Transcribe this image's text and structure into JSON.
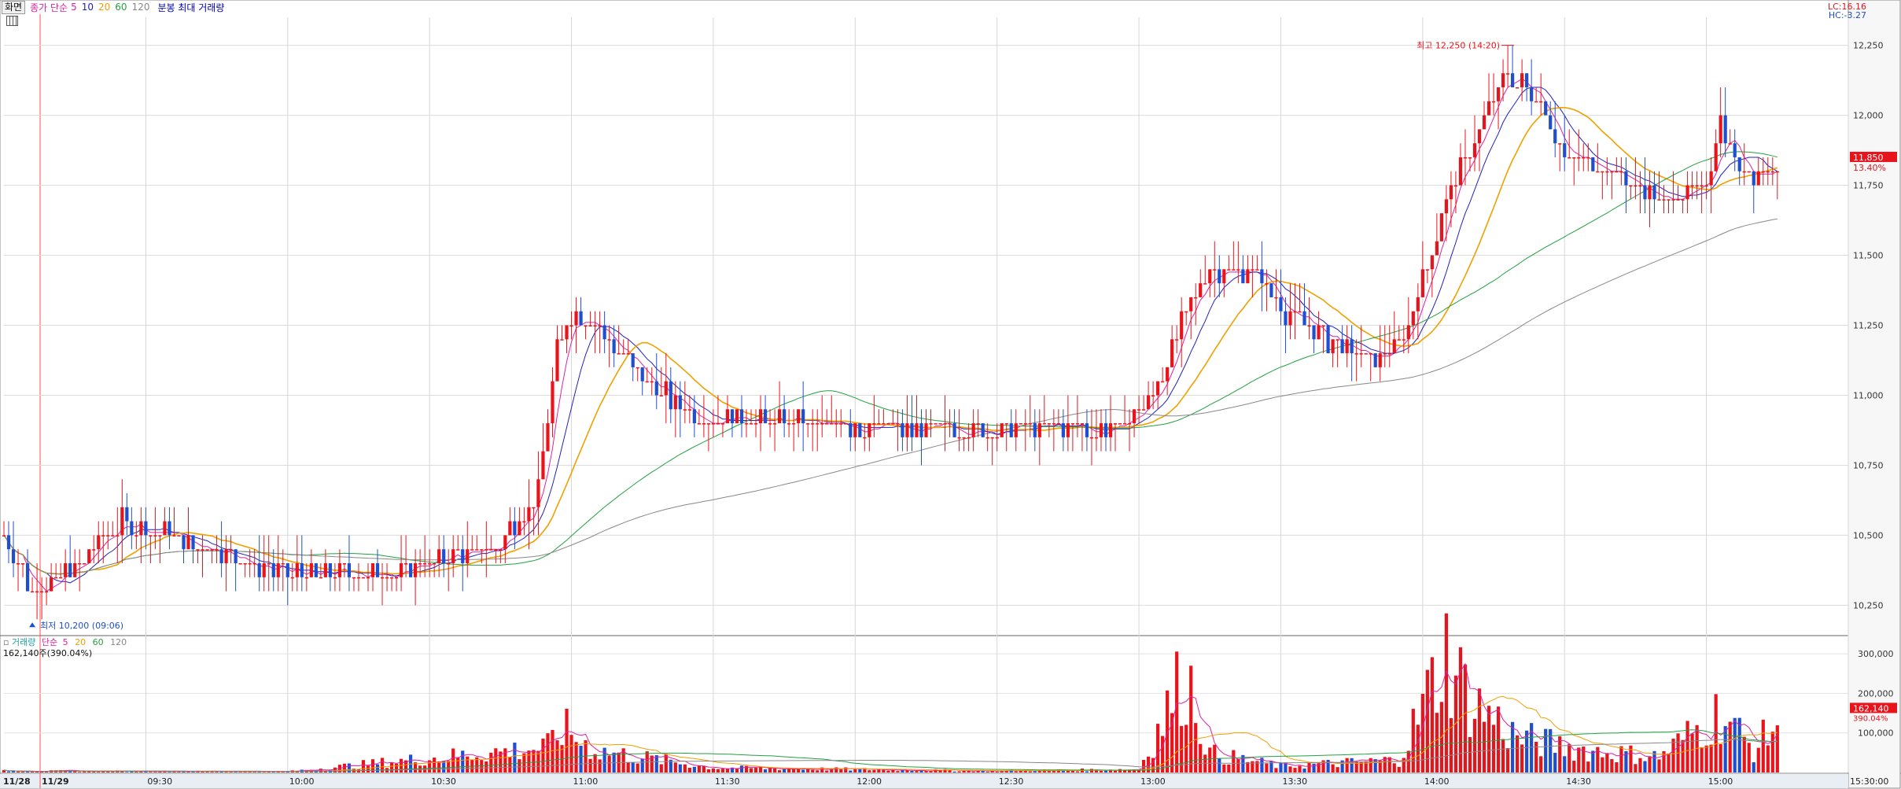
{
  "toolbar": {
    "button_label": "화면",
    "price_legend": {
      "label": "종가 단순",
      "periods": [
        "5",
        "10",
        "20",
        "60",
        "120"
      ]
    },
    "extra_legend": "분봉 최대 거래량"
  },
  "right_info": {
    "lc": "LC:16.16",
    "hc": "HC:-3.27"
  },
  "price_axis": {
    "ticks": [
      "12,250",
      "12,000",
      "11,750",
      "11,500",
      "11,250",
      "11,000",
      "10,750",
      "10,500",
      "10,250"
    ],
    "tick_values": [
      12250,
      12000,
      11750,
      11500,
      11250,
      11000,
      10750,
      10500,
      10250
    ],
    "current_price": "11,850",
    "current_pct": "13.40%"
  },
  "volume_axis": {
    "ticks": [
      "300,000",
      "200,000",
      "100,000"
    ],
    "tick_values": [
      300000,
      200000,
      100000
    ],
    "current_volume": "162,140",
    "current_ratio": "390.04%"
  },
  "volume_legend": {
    "label": "거래량",
    "ma_label": "단순",
    "periods": [
      "5",
      "20",
      "60",
      "120"
    ]
  },
  "volume_stat": "162,140주(390.04%)",
  "annotations": {
    "high": "최고 12,250 (14:20)",
    "low": "최저 10,200 (09:06)"
  },
  "time_axis": {
    "labels": [
      "11/28",
      "11/29",
      "09:30",
      "10:00",
      "10:30",
      "11:00",
      "11:30",
      "12:00",
      "12:30",
      "13:00",
      "13:30",
      "14:00",
      "14:30",
      "15:00",
      "15:30:00"
    ]
  },
  "colors": {
    "up": "#e8141b",
    "down": "#1f4fd0",
    "ma5": "#e020a0",
    "ma10": "#2020c0",
    "ma20": "#f0a000",
    "ma60": "#22a040",
    "ma120": "#888888"
  },
  "chart_data": {
    "type": "candlestick",
    "title": "",
    "session": "11/29 intraday 1-minute",
    "price_range": [
      10150,
      12350
    ],
    "volume_range": [
      0,
      330000
    ],
    "high": {
      "value": 12250,
      "time": "14:20"
    },
    "low": {
      "value": 10200,
      "time": "09:06"
    },
    "last": {
      "close": 11850,
      "change_pct": 13.4,
      "volume": 162140,
      "volume_ratio_pct": 390.04
    },
    "close_path": [
      [
        "09:00",
        10500
      ],
      [
        "09:06",
        10300
      ],
      [
        "09:15",
        10380
      ],
      [
        "09:25",
        10550
      ],
      [
        "09:35",
        10500
      ],
      [
        "09:45",
        10450
      ],
      [
        "09:55",
        10380
      ],
      [
        "10:05",
        10360
      ],
      [
        "10:20",
        10360
      ],
      [
        "10:35",
        10420
      ],
      [
        "10:45",
        10480
      ],
      [
        "10:53",
        10650
      ],
      [
        "10:57",
        11150
      ],
      [
        "11:00",
        11300
      ],
      [
        "11:05",
        11250
      ],
      [
        "11:15",
        11050
      ],
      [
        "11:25",
        10950
      ],
      [
        "11:35",
        10900
      ],
      [
        "11:45",
        10900
      ],
      [
        "11:55",
        10900
      ],
      [
        "12:10",
        10880
      ],
      [
        "12:25",
        10880
      ],
      [
        "12:40",
        10880
      ],
      [
        "12:55",
        10880
      ],
      [
        "13:03",
        11000
      ],
      [
        "13:10",
        11300
      ],
      [
        "13:15",
        11450
      ],
      [
        "13:25",
        11450
      ],
      [
        "13:30",
        11300
      ],
      [
        "13:40",
        11200
      ],
      [
        "13:50",
        11100
      ],
      [
        "13:57",
        11250
      ],
      [
        "14:05",
        11700
      ],
      [
        "14:12",
        11950
      ],
      [
        "14:18",
        12150
      ],
      [
        "14:25",
        12050
      ],
      [
        "14:30",
        11850
      ],
      [
        "14:40",
        11800
      ],
      [
        "14:50",
        11700
      ],
      [
        "15:00",
        11750
      ],
      [
        "15:03",
        12000
      ],
      [
        "15:07",
        11800
      ],
      [
        "15:12",
        11800
      ],
      [
        "15:15",
        11850
      ]
    ],
    "volume_path": [
      [
        "09:00",
        5000
      ],
      [
        "10:00",
        3000
      ],
      [
        "10:55",
        80000
      ],
      [
        "10:58",
        140000
      ],
      [
        "11:05",
        70000
      ],
      [
        "11:30",
        15000
      ],
      [
        "12:30",
        5000
      ],
      [
        "13:00",
        10000
      ],
      [
        "13:10",
        320000
      ],
      [
        "13:15",
        60000
      ],
      [
        "13:30",
        20000
      ],
      [
        "13:55",
        40000
      ],
      [
        "14:05",
        380000
      ],
      [
        "14:10",
        230000
      ],
      [
        "14:20",
        110000
      ],
      [
        "14:35",
        70000
      ],
      [
        "14:50",
        50000
      ],
      [
        "15:03",
        190000
      ],
      [
        "15:10",
        70000
      ],
      [
        "15:15",
        162140
      ]
    ]
  }
}
